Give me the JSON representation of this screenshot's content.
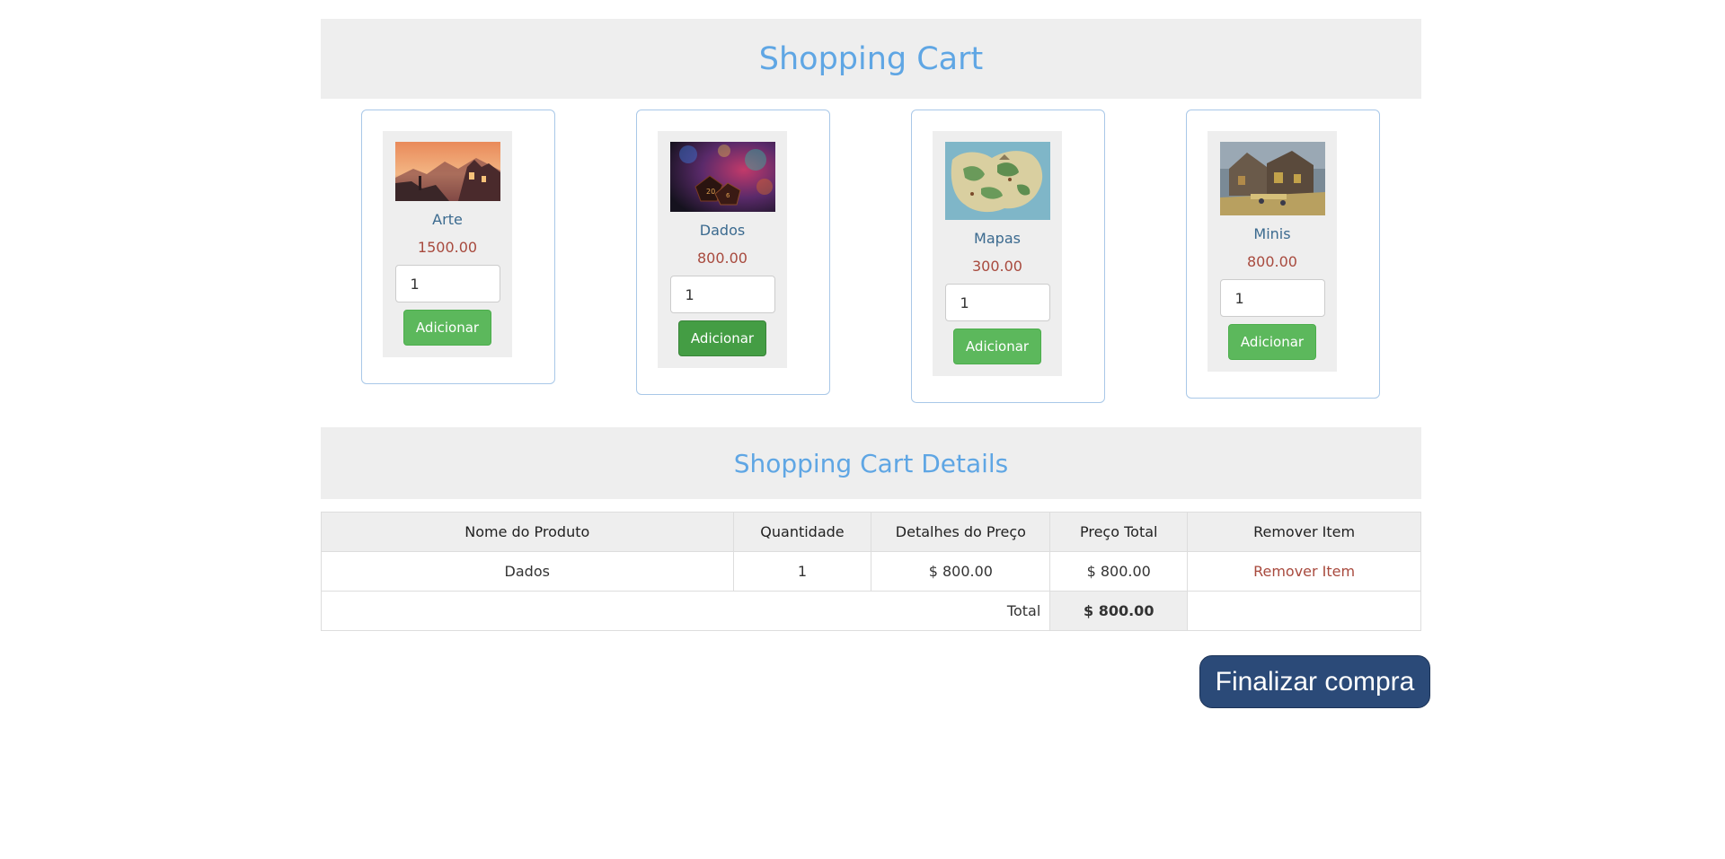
{
  "header": {
    "title": "Shopping Cart"
  },
  "products": [
    {
      "name": "Arte",
      "price": "1500.00",
      "quantity": "1",
      "button_label": "Adicionar",
      "image": "fantasy-town-sunset-image"
    },
    {
      "name": "Dados",
      "price": "800.00",
      "quantity": "1",
      "button_label": "Adicionar",
      "image": "dice-image"
    },
    {
      "name": "Mapas",
      "price": "300.00",
      "quantity": "1",
      "button_label": "Adicionar",
      "image": "fantasy-map-image"
    },
    {
      "name": "Minis",
      "price": "800.00",
      "quantity": "1",
      "button_label": "Adicionar",
      "image": "miniatures-terrain-image"
    }
  ],
  "details": {
    "title": "Shopping Cart Details",
    "columns": [
      "Nome do Produto",
      "Quantidade",
      "Detalhes do Preço",
      "Preço Total",
      "Remover Item"
    ],
    "rows": [
      {
        "name": "Dados",
        "quantity": "1",
        "price": "$ 800.00",
        "total": "$ 800.00",
        "remove": "Remover Item"
      }
    ],
    "total_label": "Total",
    "total_value": "$ 800.00"
  },
  "checkout": {
    "label": "Finalizar compra"
  },
  "colors": {
    "accent": "#5fa6e4",
    "price": "#a84a3e",
    "add_button": "#5cb85c",
    "checkout_button": "#2b4a78"
  }
}
